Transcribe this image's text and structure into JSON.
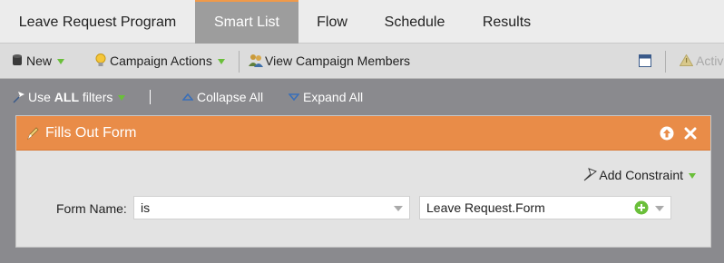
{
  "tabs": [
    {
      "label": "Leave Request Program"
    },
    {
      "label": "Smart List"
    },
    {
      "label": "Flow"
    },
    {
      "label": "Schedule"
    },
    {
      "label": "Results"
    }
  ],
  "toolbar": {
    "new_label": "New",
    "campaign_actions_label": "Campaign Actions",
    "view_members_label": "View Campaign Members",
    "active_label": "Activ"
  },
  "filterbar": {
    "use_prefix": "Use",
    "use_bold": "ALL",
    "use_suffix": "filters",
    "separator": "|",
    "collapse_label": "Collapse All",
    "expand_label": "Expand All"
  },
  "filter": {
    "title": "Fills Out Form",
    "add_constraint_label": "Add Constraint",
    "field_label": "Form Name:",
    "operator_value": "is",
    "form_value": "Leave Request.Form"
  },
  "colors": {
    "accent": "#e98c48",
    "active_tab": "#9d9d9d",
    "caret_green": "#6abf3a"
  }
}
